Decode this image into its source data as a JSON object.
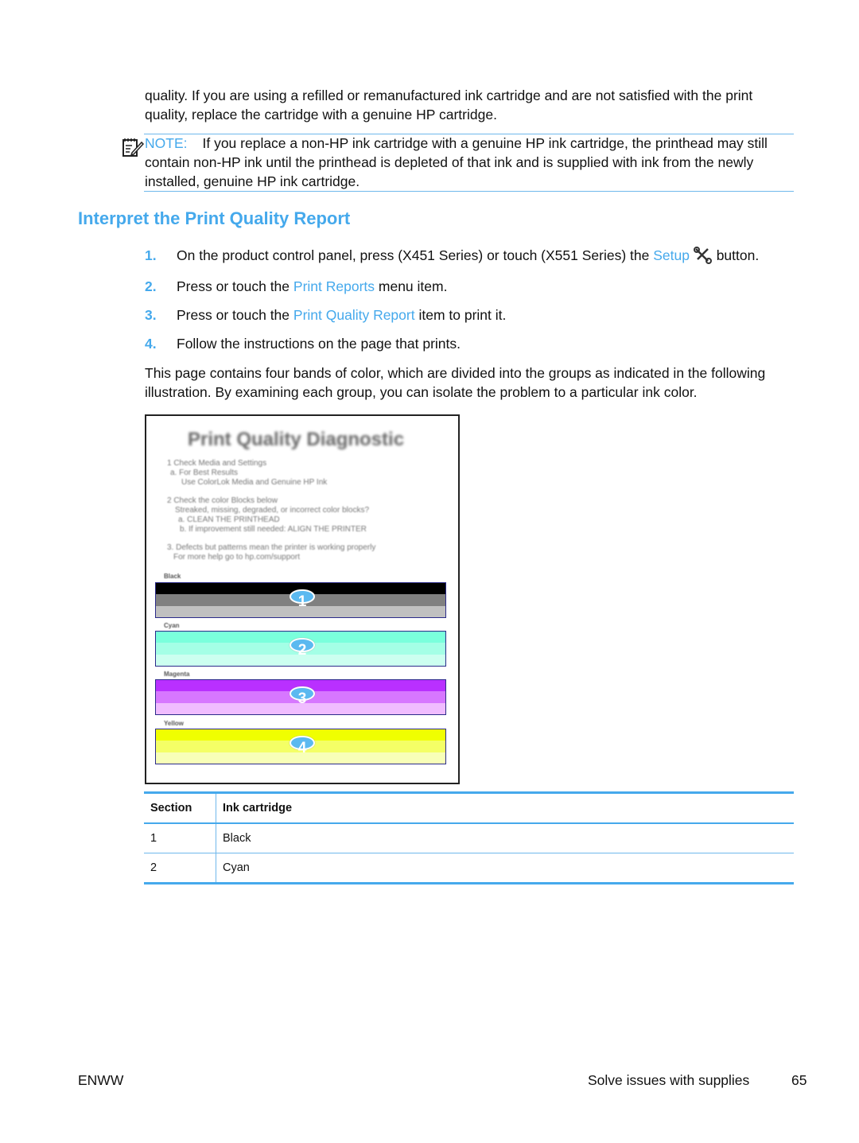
{
  "intro": {
    "line1": "quality. If you are using a refilled or remanufactured ink cartridge and are not satisfied with the print",
    "line2": "quality, replace the cartridge with a genuine HP cartridge."
  },
  "note": {
    "icon": "note-pencil-icon",
    "label": "NOTE:",
    "line1": "If you replace a non-HP ink cartridge with a genuine HP ink cartridge, the printhead may still",
    "line2": "contain non-HP ink until the printhead is depleted of that ink and is supplied with ink from the newly",
    "line3": "installed, genuine HP ink cartridge."
  },
  "heading": "Interpret the Print Quality Report",
  "steps": [
    {
      "num": "1.",
      "pre": "On the product control panel, press (X451 Series) or touch (X551 Series) the ",
      "link": "Setup",
      "icon": "wrench-screwdriver-icon",
      "post": " button."
    },
    {
      "num": "2.",
      "pre": "Press or touch the ",
      "link": "Print Reports",
      "post": " menu item."
    },
    {
      "num": "3.",
      "pre": "Press or touch the ",
      "link": "Print Quality Report",
      "post": " item to print it."
    },
    {
      "num": "4.",
      "pre": "Follow the instructions on the page that prints."
    }
  ],
  "body": {
    "line1": "This page contains four bands of color, which are divided into the groups as indicated in the following",
    "line2": "illustration. By examining each group, you can isolate the problem to a particular ink color."
  },
  "figure": {
    "title": "Print Quality Diagnostic",
    "lines": [
      "1 Check Media and Settings",
      "a. For Best Results",
      "Use ColorLok Media and Genuine HP Ink",
      "2 Check the color Blocks below",
      "Streaked, missing, degraded, or incorrect color blocks?",
      "a. CLEAN THE PRINTHEAD",
      "b. If improvement still needed: ALIGN THE PRINTER",
      "3. Defects but patterns mean the printer is working properly",
      "For more help go to hp.com/support"
    ],
    "bands": [
      {
        "label": "Black",
        "num": "1",
        "colors": [
          "#000000",
          "#808080",
          "#c0c0c0"
        ]
      },
      {
        "label": "Cyan",
        "num": "2",
        "colors": [
          "#7affdc",
          "#a4ffe6",
          "#ccfff0"
        ]
      },
      {
        "label": "Magenta",
        "num": "3",
        "colors": [
          "#b930ff",
          "#d777ff",
          "#f0bcff"
        ]
      },
      {
        "label": "Yellow",
        "num": "4",
        "colors": [
          "#f0ff00",
          "#f4ff66",
          "#f8ffb8"
        ]
      }
    ]
  },
  "table": {
    "headers": [
      "Section",
      "Ink cartridge"
    ],
    "rows": [
      [
        "1",
        "Black"
      ],
      [
        "2",
        "Cyan"
      ]
    ]
  },
  "footer": {
    "left": "ENWW",
    "title": "Solve issues with supplies",
    "page": "65"
  },
  "colors": {
    "accent": "#45a9ec"
  }
}
